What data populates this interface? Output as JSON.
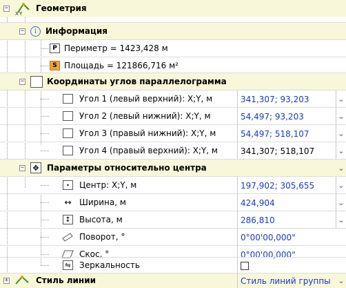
{
  "sections": {
    "geometry": {
      "label": "Геометрия",
      "icon": "xy-geometry-icon"
    },
    "info": {
      "label": "Информация",
      "icon": "info-icon"
    },
    "parallelogram": {
      "label": "Координаты углов параллелограмма",
      "icon": "rectangle-icon"
    },
    "center_params": {
      "label": "Параметры относительно центра",
      "icon": "move-center-icon"
    },
    "line_style": {
      "label": "Стиль линии",
      "icon": "line-style-icon"
    }
  },
  "info_items": [
    {
      "badge": "P",
      "label": "Периметр = 1423,428 м"
    },
    {
      "badge": "S",
      "label": "Площадь = 121866,716 м²"
    }
  ],
  "corners": [
    {
      "label": "Угол 1 (левый верхний): X;Y, м",
      "value": "341,307; 93,203"
    },
    {
      "label": "Угол 2 (левый нижний): X;Y, м",
      "value": "54,497; 93,203"
    },
    {
      "label": "Угол 3 (правый нижний): X;Y, м",
      "value": "54,497; 518,107"
    },
    {
      "label": "Угол 4 (правый верхний): X;Y, м",
      "value": "341,307; 518,107"
    }
  ],
  "center": [
    {
      "label": "Центр: X;Y, м",
      "value": "197,902; 305,655"
    },
    {
      "label": "Ширина, м",
      "value": "424,904"
    },
    {
      "label": "Высота, м",
      "value": "286,810"
    },
    {
      "label": "Поворот, °",
      "value": "0°00'00,000\""
    },
    {
      "label": "Скос, °",
      "value": "0°00'00,000\""
    },
    {
      "label": "Зеркальность",
      "value": ""
    }
  ],
  "line_style_value": "Стиль линий группы",
  "colors": {
    "section_bg": "#f8f7d9",
    "value_text": "#1a37c9",
    "badge_s": "#f0a23b"
  }
}
